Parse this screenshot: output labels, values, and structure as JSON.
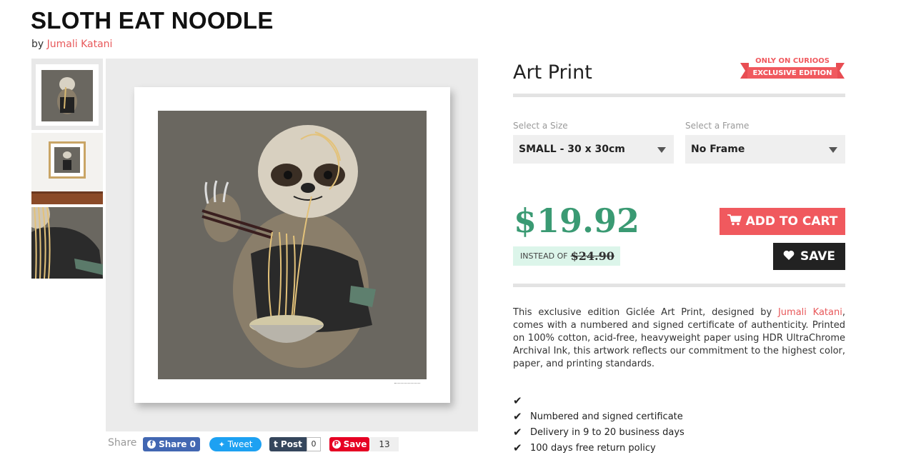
{
  "product": {
    "title": "SLOTH EAT NOODLE",
    "by_prefix": "by",
    "artist": "Jumali Katani"
  },
  "share": {
    "label": "Share",
    "facebook": "Share 0",
    "twitter": "Tweet",
    "tumblr": "Post",
    "tumblr_count": "0",
    "pinterest": "Save",
    "pinterest_count": "13"
  },
  "panel": {
    "heading": "Art Print",
    "ribbon_top": "ONLY ON CURIOOS",
    "ribbon_main": "EXCLUSIVE EDITION",
    "size_label": "Select a Size",
    "size_value": "SMALL - 30 x 30cm",
    "frame_label": "Select a Frame",
    "frame_value": "No Frame",
    "price": "$19.92",
    "instead_label": "INSTEAD OF",
    "old_price": "$24.90",
    "add_to_cart": "ADD TO CART",
    "save": "SAVE",
    "desc_before": "This exclusive edition Giclée Art Print, designed by ",
    "desc_artist": "Jumali Katani",
    "desc_after": ", comes with a numbered and signed certificate of authenticity. Printed on 100% cotton, acid-free, heavyweight paper using HDR UltraChrome Archival Ink, this artwork reflects our commitment to the highest color, paper, and printing standards.",
    "features": [
      "",
      "Numbered and signed certificate",
      "Delivery in 9 to 20 business days",
      "100 days free return policy"
    ]
  },
  "colors": {
    "accent": "#f0595e",
    "price": "#3a9a73",
    "artwork_bg": "#6a6760"
  }
}
